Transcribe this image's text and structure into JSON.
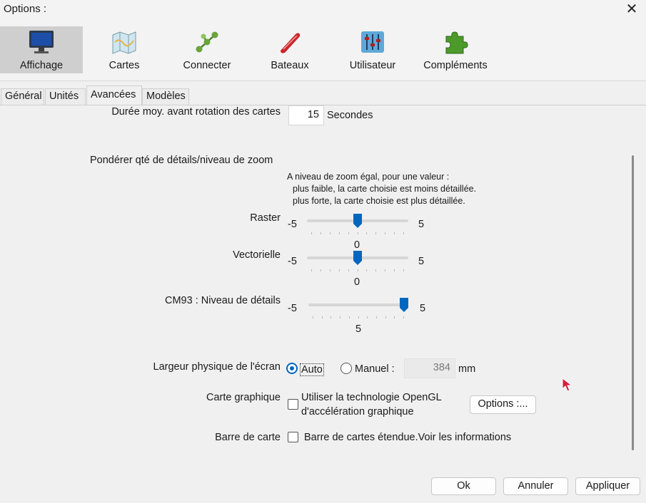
{
  "window": {
    "title": "Options :"
  },
  "toolbar": {
    "items": [
      {
        "label": "Affichage",
        "icon": "monitor-icon",
        "selected": true
      },
      {
        "label": "Cartes",
        "icon": "chart-map-icon"
      },
      {
        "label": "Connecter",
        "icon": "network-icon"
      },
      {
        "label": "Bateaux",
        "icon": "boat-icon"
      },
      {
        "label": "Utilisateur",
        "icon": "sliders-icon"
      },
      {
        "label": "Compléments",
        "icon": "puzzle-icon"
      }
    ]
  },
  "tabs": [
    {
      "label": "Général"
    },
    {
      "label": "Unités"
    },
    {
      "label": "Avancées",
      "selected": true
    },
    {
      "label": "Modèles"
    }
  ],
  "content": {
    "rotation": {
      "label": "Durée moy. avant rotation des cartes",
      "value": "15",
      "unit": "Secondes"
    },
    "detail": {
      "heading": "Pondérer qté de détails/niveau de zoom",
      "note_line1": "A niveau de zoom égal, pour une valeur :",
      "note_line2": "plus faible, la carte choisie est moins détaillée.",
      "note_line3": "plus forte, la carte choisie est plus détaillée."
    },
    "sliders": [
      {
        "label": "Raster",
        "min": "-5",
        "max": "5",
        "value": "0",
        "level": 0
      },
      {
        "label": "Vectorielle",
        "min": "-5",
        "max": "5",
        "value": "0",
        "level": 0
      },
      {
        "label": "CM93 : Niveau de détails",
        "min": "-5",
        "max": "5",
        "value": "5",
        "level": 5
      }
    ],
    "screen": {
      "label": "Largeur physique de l'écran",
      "auto_label": "Auto",
      "manual_label": "Manuel :",
      "manual_value": "384",
      "unit": "mm",
      "selected": "Auto"
    },
    "graphics": {
      "label": "Carte graphique",
      "opengl_line1": "Utiliser la technologie OpenGL",
      "opengl_line2": "d'accélération graphique",
      "opengl_checked": false,
      "options_button": "Options :..."
    },
    "chartbar": {
      "label": "Barre de carte",
      "checkbox_label": "Barre de cartes étendue.Voir les informations",
      "checked": false
    }
  },
  "footer": {
    "ok": "Ok",
    "cancel": "Annuler",
    "apply": "Appliquer"
  },
  "colors": {
    "accent": "#0067c0",
    "selected_tool_bg": "#cfcfcf"
  }
}
